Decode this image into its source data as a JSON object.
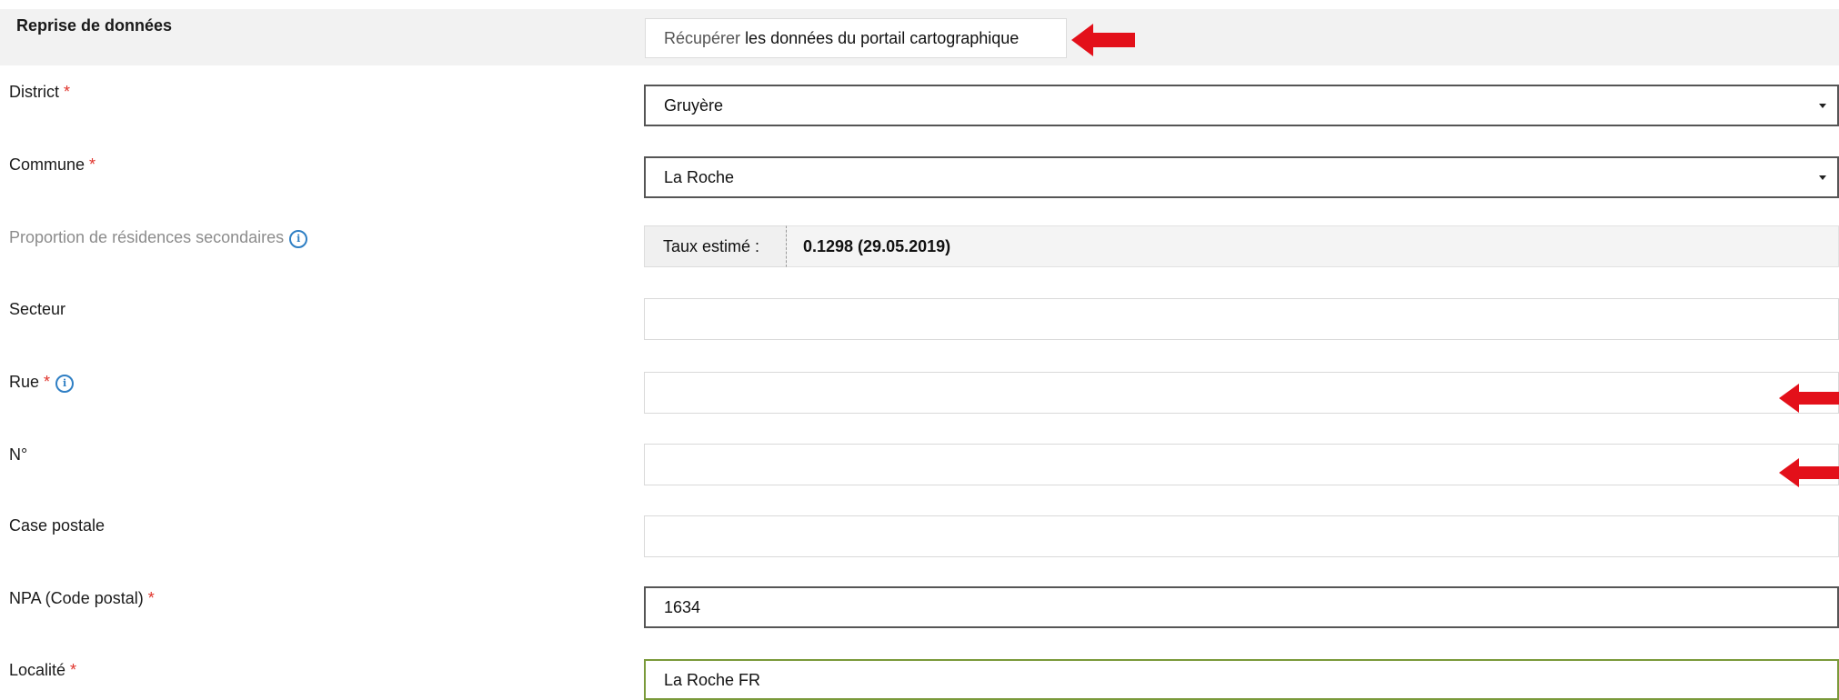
{
  "reprise": {
    "label": "Reprise de données",
    "button_prefix": "Récupérer",
    "button_rest": "les données du portail cartographique"
  },
  "district": {
    "label": "District",
    "required": "*",
    "value": "Gruyère"
  },
  "commune": {
    "label": "Commune",
    "required": "*",
    "value": "La Roche"
  },
  "proportion": {
    "label": "Proportion de résidences secondaires",
    "addon": "Taux estimé :",
    "value": "0.1298 (29.05.2019)"
  },
  "secteur": {
    "label": "Secteur",
    "value": ""
  },
  "rue": {
    "label": "Rue",
    "required": "*",
    "value": ""
  },
  "numero": {
    "label": "N°",
    "value": ""
  },
  "case_postale": {
    "label": "Case postale",
    "value": ""
  },
  "npa": {
    "label": "NPA (Code postal)",
    "required": "*",
    "value": "1634"
  },
  "localite": {
    "label": "Localité",
    "required": "*",
    "value": "La Roche FR"
  },
  "icons": {
    "info": "info-icon",
    "dropdown": "chevron-down-icon",
    "annotation": "red-arrow-icon"
  },
  "colors": {
    "required": "#e0342c",
    "info": "#2f7fc4",
    "arrow": "#e3101a"
  }
}
